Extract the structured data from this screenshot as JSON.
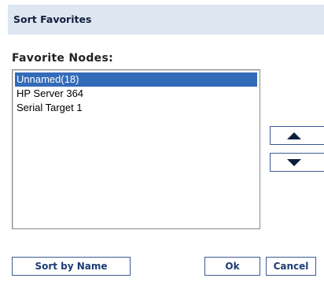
{
  "dialog": {
    "title": "Sort Favorites"
  },
  "favorites": {
    "label": "Favorite Nodes:",
    "items": [
      {
        "label": "Unnamed(18)",
        "selected": true
      },
      {
        "label": "HP Server 364",
        "selected": false
      },
      {
        "label": "Serial Target 1",
        "selected": false
      }
    ]
  },
  "controls": {
    "move_up_icon": "triangle-up",
    "move_down_icon": "triangle-down"
  },
  "buttons": {
    "sort_by_name": "Sort by Name",
    "ok": "Ok",
    "cancel": "Cancel"
  },
  "colors": {
    "title_bar": "#dde6f1",
    "selection": "#336bb9",
    "button_text": "#1d3c74",
    "button_border": "#3a5b94"
  }
}
